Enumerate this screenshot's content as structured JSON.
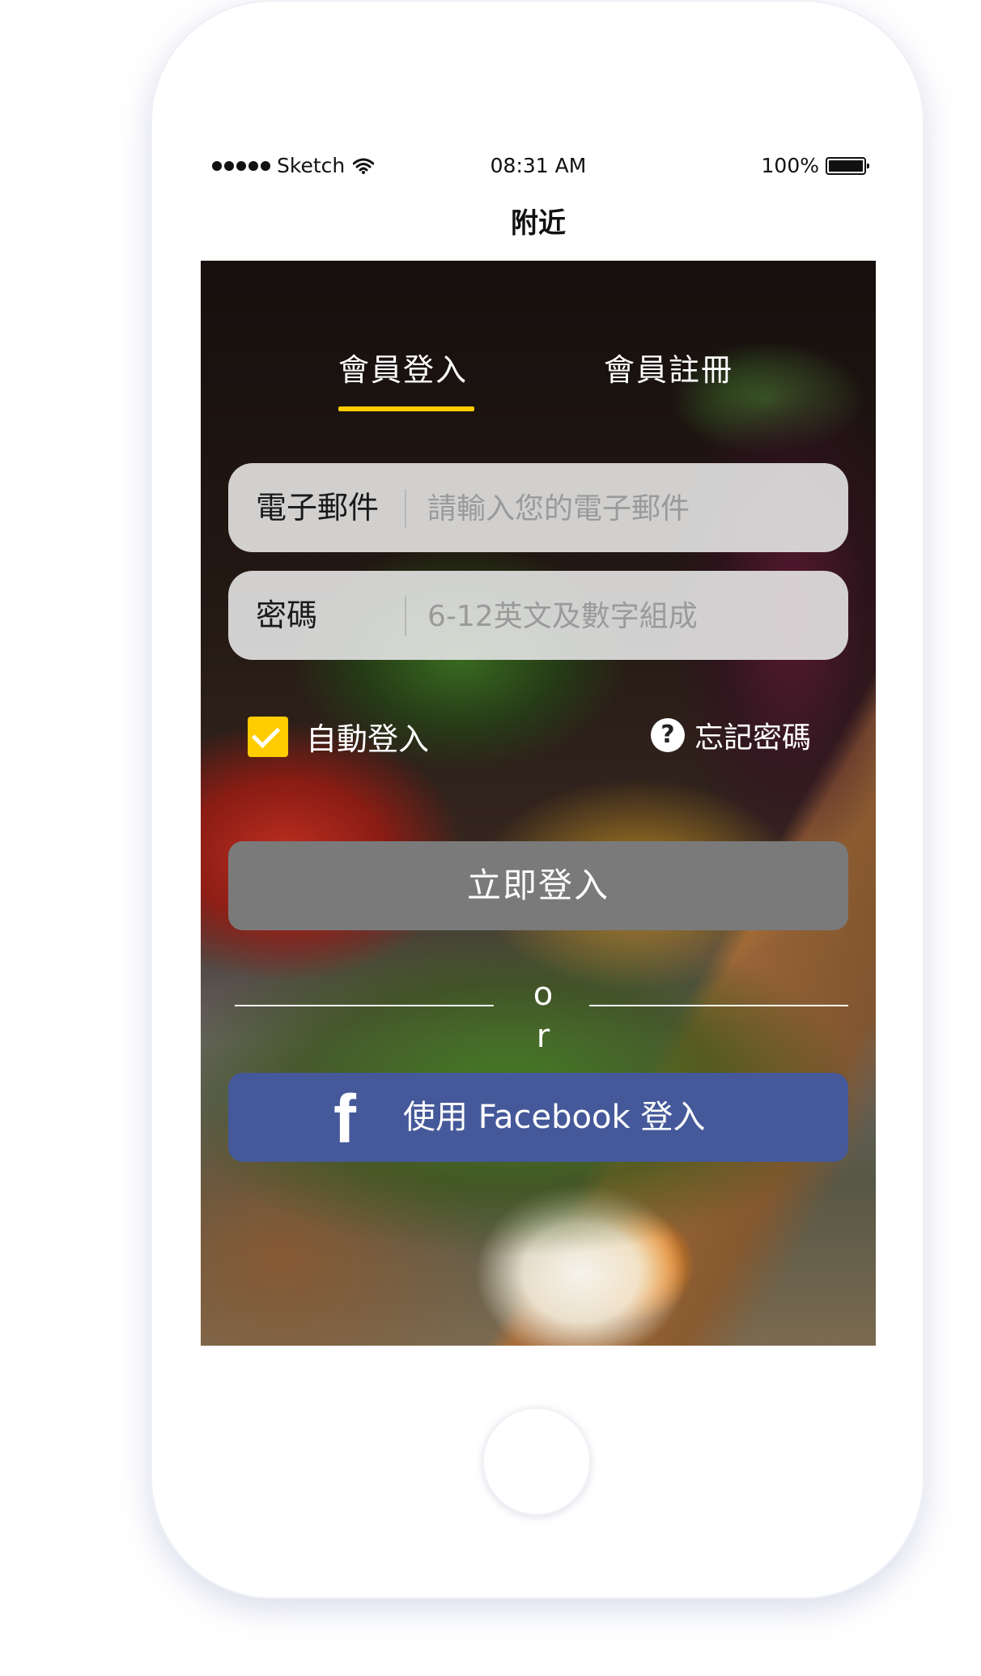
{
  "status_bar": {
    "carrier": "Sketch",
    "time": "08:31 AM",
    "battery": "100%"
  },
  "nav": {
    "title": "附近"
  },
  "tabs": [
    {
      "label": "會員登入",
      "active": true
    },
    {
      "label": "會員註冊",
      "active": false
    }
  ],
  "form": {
    "email": {
      "label": "電子郵件",
      "placeholder": "請輸入您的電子郵件",
      "value": ""
    },
    "password": {
      "label": "密碼",
      "placeholder": "6-12英文及數字組成",
      "value": ""
    },
    "remember": {
      "label": "自動登入",
      "checked": true
    },
    "forgot": {
      "label": "忘記密碼"
    },
    "submit_label": "立即登入",
    "or_text": "or",
    "facebook_label": "使用 Facebook 登入",
    "facebook_glyph": "f"
  },
  "colors": {
    "accent": "#ffcc00",
    "facebook": "#45599a",
    "submit_button": "#7a7a7a"
  },
  "icons": [
    "signal-dots-icon",
    "wifi-icon",
    "battery-icon",
    "checkmark-icon",
    "help-circle-icon",
    "facebook-icon"
  ]
}
